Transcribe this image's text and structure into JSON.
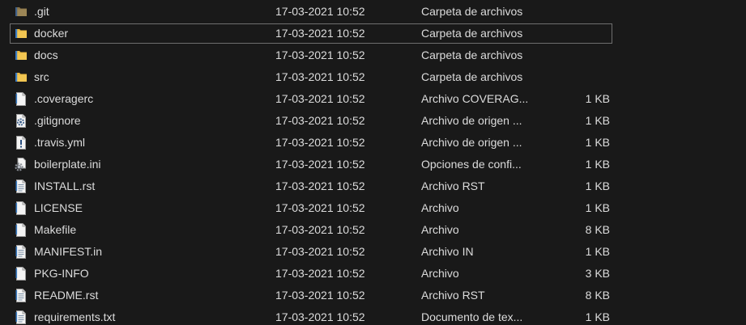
{
  "rows": [
    {
      "icon": "folder-icon-hidden",
      "name": ".git",
      "date": "17-03-2021 10:52",
      "type": "Carpeta de archivos",
      "size": ""
    },
    {
      "icon": "folder-icon",
      "name": "docker",
      "date": "17-03-2021 10:52",
      "type": "Carpeta de archivos",
      "size": "",
      "selected": true
    },
    {
      "icon": "folder-icon",
      "name": "docs",
      "date": "17-03-2021 10:52",
      "type": "Carpeta de archivos",
      "size": ""
    },
    {
      "icon": "folder-icon",
      "name": "src",
      "date": "17-03-2021 10:52",
      "type": "Carpeta de archivos",
      "size": ""
    },
    {
      "icon": "file-icon",
      "name": ".coveragerc",
      "date": "17-03-2021 10:52",
      "type": "Archivo COVERAG...",
      "size": "1 KB"
    },
    {
      "icon": "config-file-icon",
      "name": ".gitignore",
      "date": "17-03-2021 10:52",
      "type": "Archivo de origen ...",
      "size": "1 KB"
    },
    {
      "icon": "script-file-icon",
      "name": ".travis.yml",
      "date": "17-03-2021 10:52",
      "type": "Archivo de origen ...",
      "size": "1 KB"
    },
    {
      "icon": "settings-file-icon",
      "name": "boilerplate.ini",
      "date": "17-03-2021 10:52",
      "type": "Opciones de confi...",
      "size": "1 KB"
    },
    {
      "icon": "text-file-icon",
      "name": "INSTALL.rst",
      "date": "17-03-2021 10:52",
      "type": "Archivo RST",
      "size": "1 KB"
    },
    {
      "icon": "file-icon",
      "name": "LICENSE",
      "date": "17-03-2021 10:52",
      "type": "Archivo",
      "size": "1 KB"
    },
    {
      "icon": "file-icon",
      "name": "Makefile",
      "date": "17-03-2021 10:52",
      "type": "Archivo",
      "size": "8 KB"
    },
    {
      "icon": "text-file-icon",
      "name": "MANIFEST.in",
      "date": "17-03-2021 10:52",
      "type": "Archivo IN",
      "size": "1 KB"
    },
    {
      "icon": "file-icon",
      "name": "PKG-INFO",
      "date": "17-03-2021 10:52",
      "type": "Archivo",
      "size": "3 KB"
    },
    {
      "icon": "text-file-icon",
      "name": "README.rst",
      "date": "17-03-2021 10:52",
      "type": "Archivo RST",
      "size": "8 KB"
    },
    {
      "icon": "text-file-icon",
      "name": "requirements.txt",
      "date": "17-03-2021 10:52",
      "type": "Documento de tex...",
      "size": "1 KB"
    }
  ],
  "colors": {
    "background": "#191919",
    "text": "#dcdcdc",
    "folder": "#e8b73f",
    "selection_border": "#6e6e6e"
  }
}
